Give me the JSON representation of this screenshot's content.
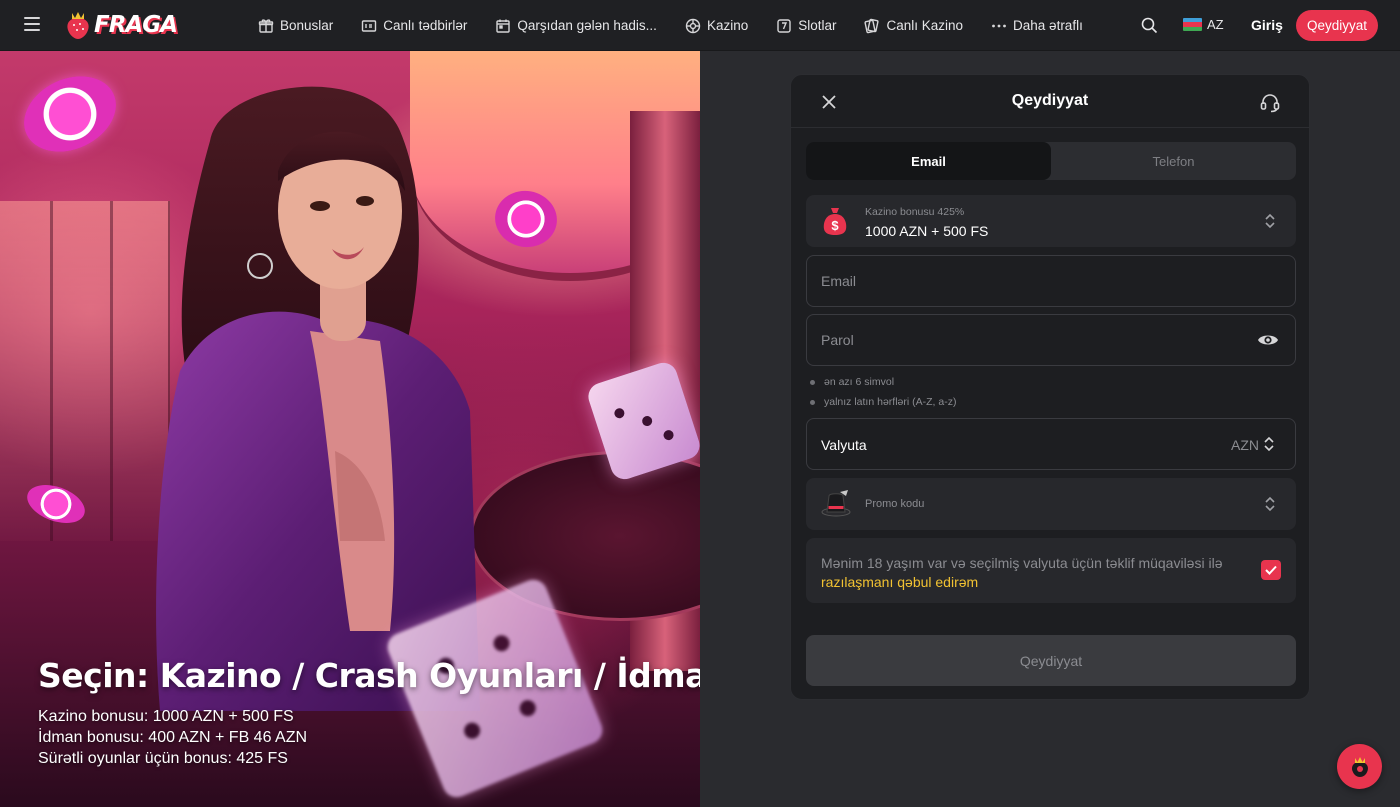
{
  "header": {
    "logo_text": "FRAGA",
    "nav": [
      {
        "label": "Bonuslar",
        "icon": "gift-icon"
      },
      {
        "label": "Canlı tədbirlər",
        "icon": "live-scoreboard-icon"
      },
      {
        "label": "Qarşıdan gələn hadis...",
        "icon": "calendar-icon"
      },
      {
        "label": "Kazino",
        "icon": "roulette-icon"
      },
      {
        "label": "Slotlar",
        "icon": "slot-machine-icon"
      },
      {
        "label": "Canlı Kazino",
        "icon": "cards-icon"
      },
      {
        "label": "Daha ətraflı",
        "icon": "more-dots-icon"
      }
    ],
    "language": "AZ",
    "login_label": "Giriş",
    "register_label": "Qeydiyyat"
  },
  "hero": {
    "title": "Seçin: Kazino / Crash Oyunları / İdman",
    "lines": [
      "Kazino bonusu: 1000 AZN + 500 FS",
      "İdman bonusu: 400 AZN + FB 46 AZN",
      "Sürətli oyunlar üçün bonus: 425 FS"
    ]
  },
  "modal": {
    "title": "Qeydiyyat",
    "tabs": [
      {
        "label": "Email",
        "active": true
      },
      {
        "label": "Telefon",
        "active": false
      }
    ],
    "bonus": {
      "label": "Kazino bonusu 425%",
      "value": "1000 AZN + 500 FS"
    },
    "email_placeholder": "Email",
    "password_placeholder": "Parol",
    "password_rules": [
      "ən azı 6 simvol",
      "yalnız latın hərfləri (A-Z, a-z)"
    ],
    "currency": {
      "label": "Valyuta",
      "value": "AZN"
    },
    "promo_label": "Promo kodu",
    "consent": {
      "text": "Mənim 18 yaşım var və seçilmiş valyuta üçün təklif müqaviləsi ilə",
      "link": "razılaşmanı qəbul edirəm",
      "checked": true
    },
    "submit_label": "Qeydiyyat"
  },
  "colors": {
    "accent": "#e8344e",
    "link": "#f1c232",
    "panel": "#1d1e21",
    "background": "#2a2b2f"
  }
}
